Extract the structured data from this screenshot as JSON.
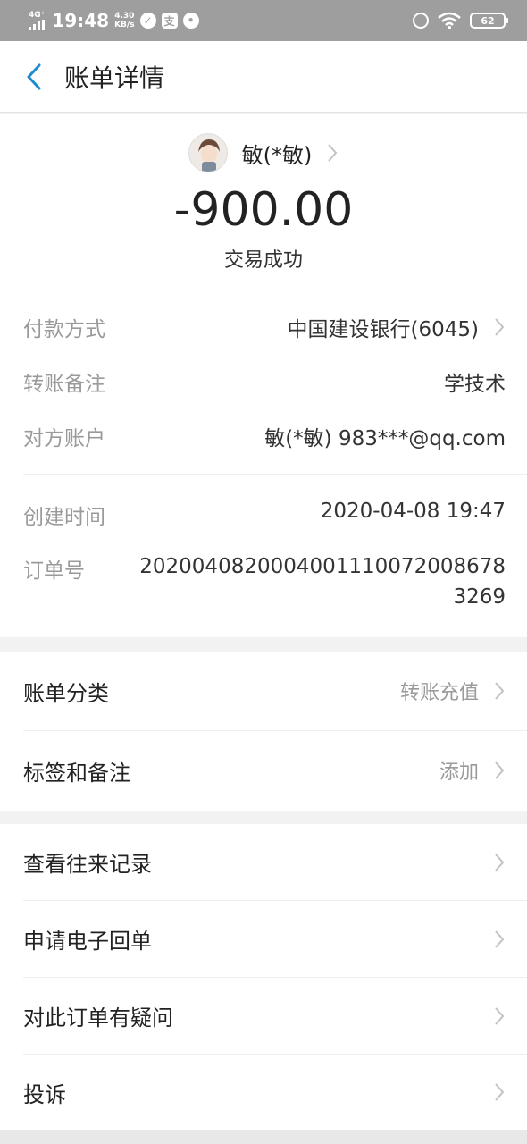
{
  "status_bar": {
    "network": "4G⁺",
    "time": "19:48",
    "speed_value": "4.30",
    "speed_unit": "KB/s",
    "battery": "62"
  },
  "nav": {
    "title": "账单详情"
  },
  "summary": {
    "payee_name": "敏(*敏)",
    "amount": "-900.00",
    "status": "交易成功"
  },
  "details": [
    {
      "label": "付款方式",
      "value": "中国建设银行(6045)"
    },
    {
      "label": "转账备注",
      "value": "学技术"
    },
    {
      "label": "对方账户",
      "value": "敏(*敏) 983***@qq.com"
    },
    {
      "label": "创建时间",
      "value": "2020-04-08 19:47"
    },
    {
      "label": "订单号",
      "value": "2020040820004001110072008678326 9"
    }
  ],
  "order_no": "20200408200040011100720086783269",
  "category_section": [
    {
      "label": "账单分类",
      "extra": "转账充值"
    },
    {
      "label": "标签和备注",
      "extra": "添加"
    }
  ],
  "action_section": [
    {
      "label": "查看往来记录"
    },
    {
      "label": "申请电子回单"
    },
    {
      "label": "对此订单有疑问"
    },
    {
      "label": "投诉"
    }
  ]
}
